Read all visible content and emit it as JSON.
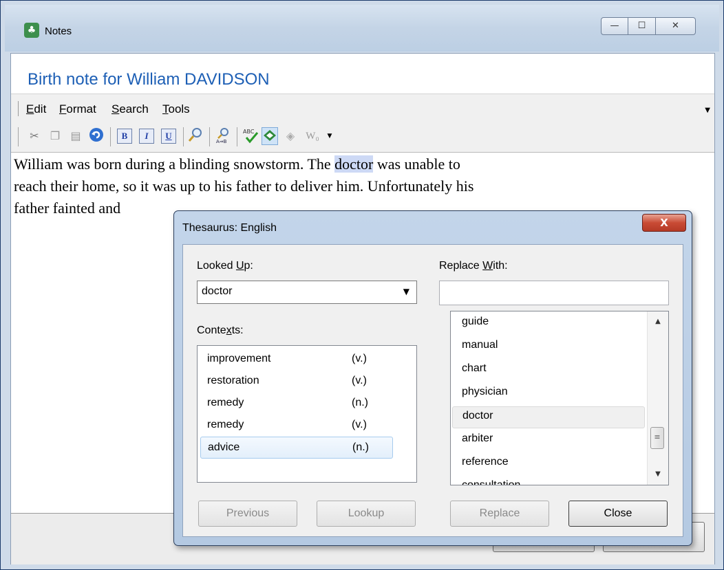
{
  "window": {
    "title": "Notes",
    "buttons": {
      "minimize": "—",
      "maximize": "☐",
      "close": "✕"
    }
  },
  "note": {
    "heading": "Birth note for William DAVIDSON",
    "lines": [
      {
        "before": "William was born during a blinding snowstorm.  The ",
        "highlight": "doctor",
        "after": " was unable to"
      },
      {
        "text": "reach their home, so it was up to his father to deliver him.  Unfortunately his"
      },
      {
        "text": "father fainted and"
      }
    ]
  },
  "menu": {
    "edit": {
      "key": "E",
      "rest": "dit"
    },
    "format": {
      "key": "F",
      "rest": "ormat"
    },
    "search": {
      "key": "S",
      "rest": "earch"
    },
    "tools": {
      "key": "T",
      "rest": "ools"
    }
  },
  "toolbar": {
    "icons": [
      "cut-icon",
      "copy-icon",
      "paste-icon",
      "undo-icon",
      "bold-icon",
      "italic-icon",
      "underline-icon",
      "find-icon",
      "replace-icon",
      "spellcheck-icon",
      "thesaurus-icon",
      "grammar-icon",
      "word-count-icon"
    ],
    "bold": "B",
    "italic": "I",
    "underline": "U"
  },
  "thesaurus": {
    "title": "Thesaurus: English",
    "close_glyph": "X",
    "looked_up_label": {
      "before": "Looked ",
      "key": "U",
      "after": "p:"
    },
    "looked_up_value": "doctor",
    "replace_with_label": {
      "before": "Replace ",
      "key": "W",
      "after": "ith:"
    },
    "replace_with_value": "",
    "contexts_label": {
      "before": "Conte",
      "key": "x",
      "after": "ts:"
    },
    "contexts": [
      {
        "word": "improvement",
        "pos": "(v.)"
      },
      {
        "word": "restoration",
        "pos": "(v.)"
      },
      {
        "word": "remedy",
        "pos": "(n.)"
      },
      {
        "word": "remedy",
        "pos": "(v.)"
      },
      {
        "word": "advice",
        "pos": "(n.)"
      }
    ],
    "selected_context": "advice",
    "synonyms": [
      "guide",
      "manual",
      "chart",
      "physician",
      "doctor",
      "arbiter",
      "reference",
      "consultation"
    ],
    "selected_synonym": "doctor",
    "buttons": {
      "previous": "Previous",
      "lookup": "Lookup",
      "replace": "Replace",
      "close": "Close"
    }
  }
}
